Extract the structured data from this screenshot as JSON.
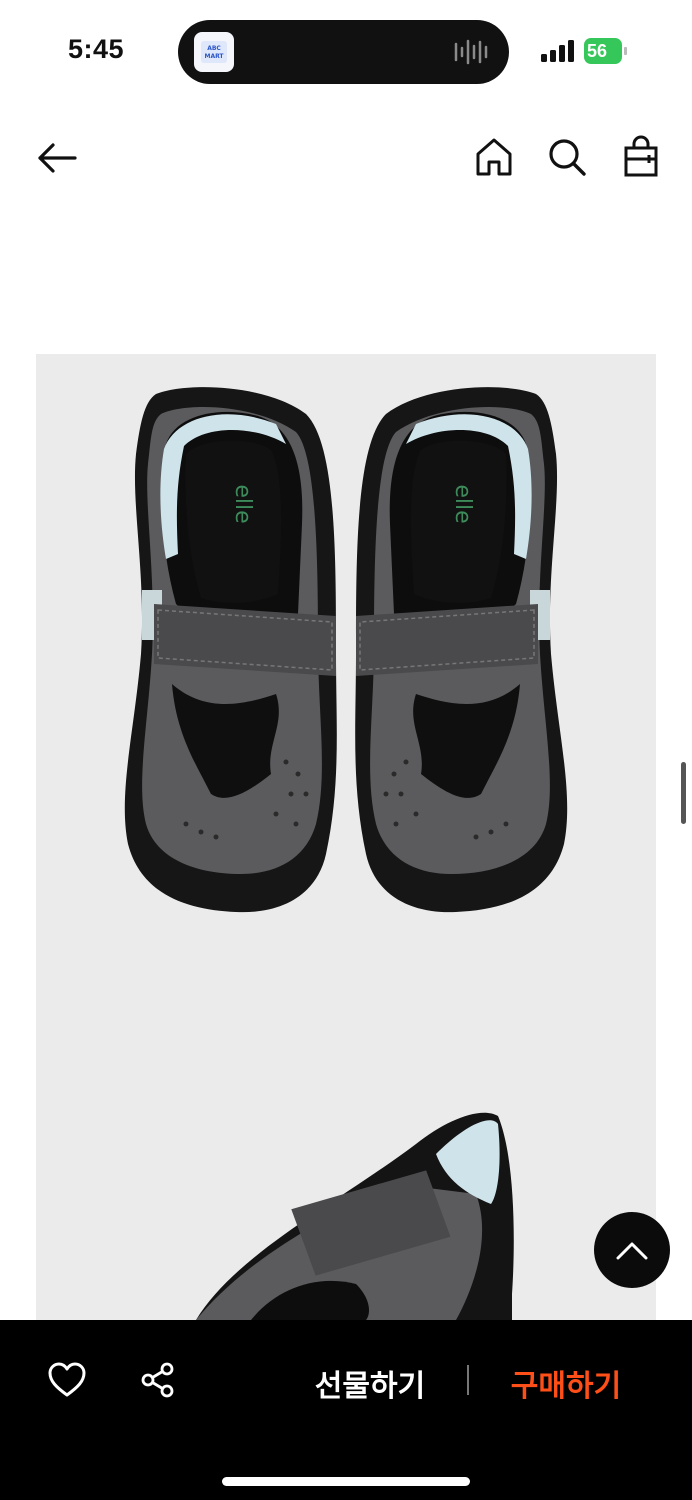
{
  "status_bar": {
    "time": "5:45",
    "battery_level": "56",
    "island_app_icon": "app-badge-icon",
    "island_wave_icon": "audio-wave-icon"
  },
  "nav": {
    "back_icon": "arrow-left-icon",
    "home_icon": "home-icon",
    "search_icon": "search-icon",
    "cart_icon": "shopping-bag-icon"
  },
  "product": {
    "image_main": "top view of a pair of grey suede velcro sandals",
    "image_secondary": "side view of grey velcro sandal"
  },
  "actions": {
    "wishlist_icon": "heart-icon",
    "share_icon": "share-icon",
    "gift_label": "선물하기",
    "buy_label": "구매하기",
    "scroll_top_icon": "chevron-up-icon"
  },
  "colors": {
    "buy_accent": "#ff4f19",
    "bottom_bar": "#000000",
    "product_bg": "#ebebeb"
  }
}
